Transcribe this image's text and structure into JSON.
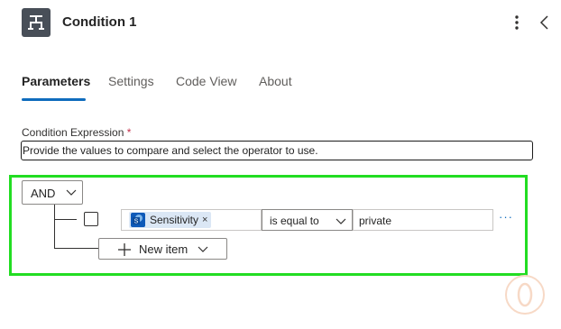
{
  "header": {
    "title": "Condition 1",
    "icon": "condition-icon",
    "menu_icon": "more-vertical-icon",
    "collapse_icon": "chevron-left-icon"
  },
  "tabs": [
    {
      "label": "Parameters",
      "active": true
    },
    {
      "label": "Settings",
      "active": false
    },
    {
      "label": "Code View",
      "active": false
    },
    {
      "label": "About",
      "active": false
    }
  ],
  "condition": {
    "label": "Condition Expression",
    "required_mark": "*",
    "description": "Provide the values to compare and select the operator to use.",
    "group_operator": "AND",
    "rows": [
      {
        "left_token": "Sensitivity",
        "left_token_icon": "sharepoint-icon",
        "token_remove": "×",
        "operator": "is equal to",
        "right_value": "private",
        "more": "···"
      }
    ],
    "new_item_label": "New item"
  },
  "colors": {
    "accent": "#0f6cbd",
    "highlight": "#22dd22",
    "token_bg": "#dbe7f5",
    "header_icon_bg": "#484f58"
  }
}
